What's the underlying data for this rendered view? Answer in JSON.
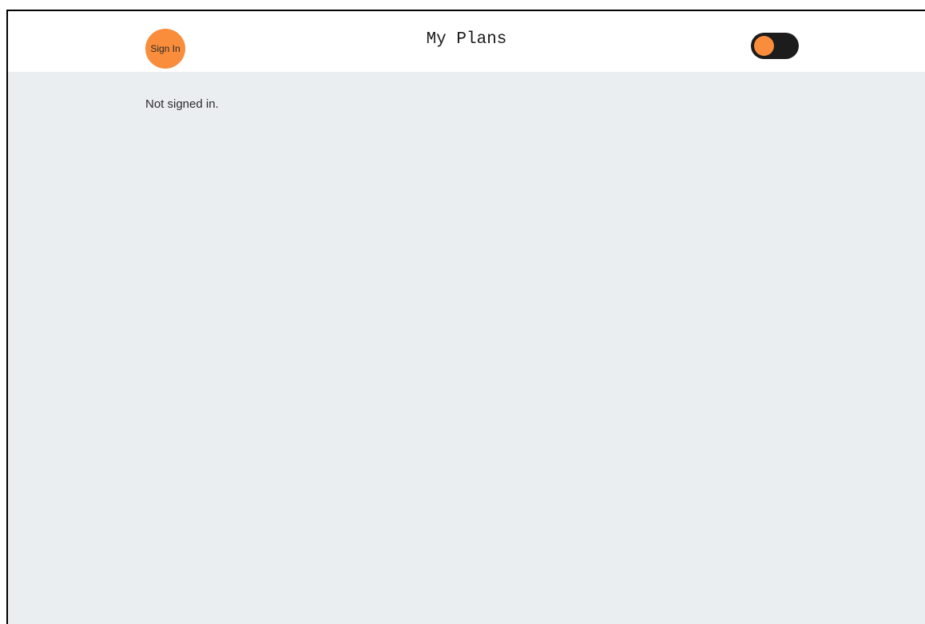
{
  "header": {
    "signin_label": "Sign In",
    "title": "My Plans",
    "theme_toggle": {
      "state": "off"
    }
  },
  "main": {
    "status_text": "Not signed in."
  },
  "colors": {
    "accent": "#f98d3b",
    "header_bg": "#ffffff",
    "page_bg": "#ebeef1",
    "toggle_track": "#1c1c1c"
  }
}
